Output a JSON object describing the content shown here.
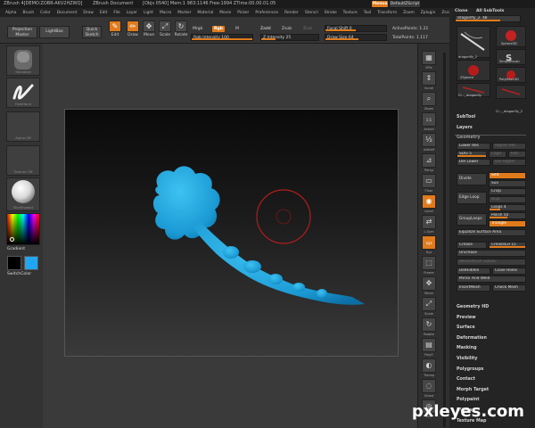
{
  "titlebar": {
    "app": "ZBrush 4[DEMO:ZOBR-AKV2HZWQ]",
    "document": "ZBrush Document",
    "stats": "[Objs 0540]  Mem:1 983:1146  Free:1994  ZTime:00.00.01.05",
    "menus_label": "Menus",
    "script_label": "DefaultZScript"
  },
  "menubar": {
    "items": [
      "Alpha",
      "Brush",
      "Color",
      "Document",
      "Draw",
      "Edit",
      "File",
      "Layer",
      "Light",
      "Macro",
      "Marker",
      "Material",
      "Movie",
      "Picker",
      "Preferences",
      "Render",
      "Stencil",
      "Stroke",
      "Texture",
      "Tool",
      "Transform",
      "Zoom",
      "Zplugin",
      "Zscript"
    ]
  },
  "toolbar": {
    "projection_master": "Projection Master",
    "lightbox": "LightBox",
    "quick_sketch": "Quick Sketch",
    "edit": "Edit",
    "draw": "Draw",
    "move": "Move",
    "scale": "Scale",
    "rotate": "Rotate",
    "mrgb": "Mrgb",
    "rgb": "Rgb",
    "m": "M",
    "zadd": "Zadd",
    "zsub": "Zsub",
    "zcut": "Zcut",
    "rgb_intensity": "Rgb Intensity 100",
    "z_intensity": "Z Intensity 25",
    "focal_shift": "Focal Shift 0",
    "draw_size": "Draw Size 64",
    "active_points": "ActivePoints: 1.21",
    "total_points": "TotalPoints: 1.117"
  },
  "lefttray": {
    "brush_label": "Standard",
    "stroke_label": "FreeHand",
    "alpha_label": "Alpha Off",
    "texture_label": "Texture Off",
    "material_label": "SkinShade4",
    "gradient_label": "Gradient",
    "switchcolor_label": "SwitchColor"
  },
  "shelf": {
    "items": [
      "SPix",
      "Scroll",
      "Zoom",
      "Actual",
      "AAHalf",
      "Persp",
      "Floor",
      "Local",
      "L.Sym",
      "Xyz",
      "Frame",
      "Move",
      "Scale",
      "Rotate",
      "PolyF",
      "Transp",
      "Ghost",
      "Solo"
    ],
    "active": [
      "Local",
      "Xyz"
    ]
  },
  "panel": {
    "clone_label": "Clone",
    "all_subtools": "All SubTools",
    "current_tool": "dragonfly_2. 48",
    "tool_names": [
      "dragonfly_2",
      "Sphere3D",
      "SimpleBrush",
      "ZSphere",
      "PolyMesh3D",
      "Cl..._dragonfly",
      "Cl..._dragonfly_2"
    ],
    "subtool": "SubTool",
    "layers": "Layers",
    "geometry": "Geometry",
    "lower_res": "Lower Res",
    "higher_res": "Higher Res",
    "sdiv": "SDiv 5",
    "cage": "Cage",
    "rstr": "Rstr",
    "del_lower": "Del Lower",
    "del_higher": "Del Higher",
    "divide": "Divide",
    "smt": "Smt",
    "suv": "Suv",
    "edge_loop": "Edge Loop",
    "crisp": "Crisp",
    "disp": "Disp",
    "loops": "Loops 4",
    "grouploops": "GroupLoops",
    "polish": "Polish 50",
    "triangle": "Triangle",
    "equalize": "Equalize Surface Area",
    "crease": "Crease",
    "crease_lvl": "CreaseLvl 15",
    "uncrease": "Uncrease",
    "reconstruct": "Reconstruct Subdiv",
    "delhidden": "DelHidden",
    "close_holes": "Close Holes",
    "mirror_weld": "Mirror And Weld",
    "insert_mesh": "InsertMesh",
    "check_mesh": "Check Mesh",
    "sections": [
      "Geometry HD",
      "Preview",
      "Surface",
      "Deformation",
      "Masking",
      "Visibility",
      "Polygroups",
      "Contact",
      "Morph Target",
      "Polypaint",
      "UV Map",
      "Texture Map"
    ]
  },
  "watermark": "pxleyes.com",
  "colors": {
    "accent": "#e07b1c",
    "model": "#1f9fd6",
    "brush_ring": "#b01d1d"
  }
}
